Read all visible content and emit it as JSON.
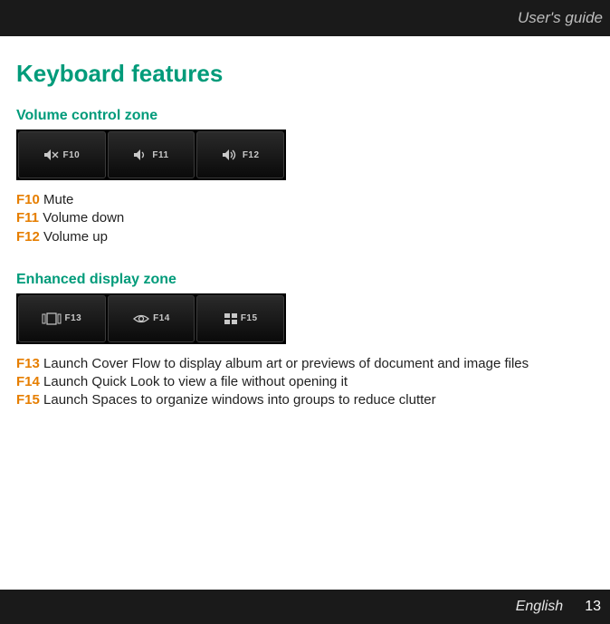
{
  "header": {
    "title": "User's guide"
  },
  "main": {
    "title": "Keyboard features",
    "sections": [
      {
        "title": "Volume control zone",
        "keys": [
          {
            "icon": "mute-icon",
            "label": "F10"
          },
          {
            "icon": "vol-down-icon",
            "label": "F11"
          },
          {
            "icon": "vol-up-icon",
            "label": "F12"
          }
        ],
        "lines": [
          {
            "fkey": "F10",
            "text": "Mute"
          },
          {
            "fkey": "F11",
            "text": "Volume down"
          },
          {
            "fkey": "F12",
            "text": "Volume up"
          }
        ]
      },
      {
        "title": "Enhanced display zone",
        "keys": [
          {
            "icon": "coverflow-icon",
            "label": "F13"
          },
          {
            "icon": "quicklook-icon",
            "label": "F14"
          },
          {
            "icon": "spaces-icon",
            "label": "F15"
          }
        ],
        "lines": [
          {
            "fkey": "F13",
            "text": "Launch Cover Flow to display album art or previews of document and image files"
          },
          {
            "fkey": "F14",
            "text": "Launch Quick Look to view a file without opening it"
          },
          {
            "fkey": "F15",
            "text": "Launch Spaces to organize windows into groups to reduce clutter"
          }
        ]
      }
    ]
  },
  "footer": {
    "language": "English",
    "page": "13"
  }
}
